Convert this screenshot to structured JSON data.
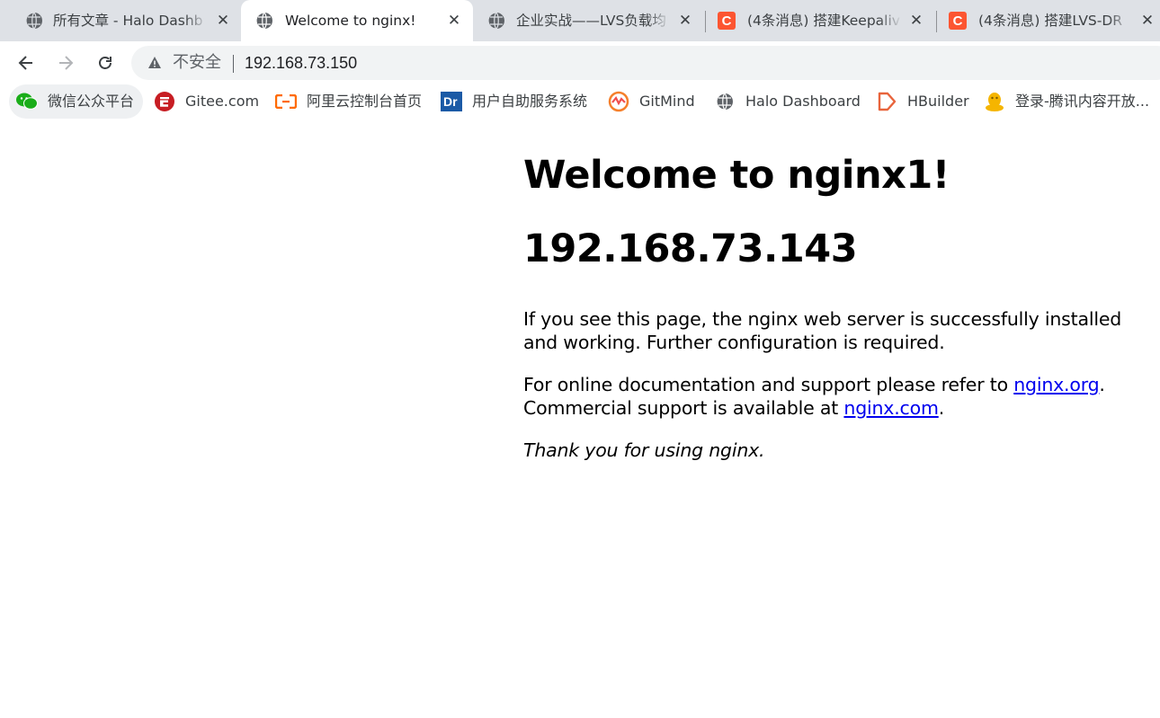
{
  "tabs": [
    {
      "title": "所有文章 - Halo Dashb",
      "favicon": "globe-icon",
      "active": false
    },
    {
      "title": "Welcome to nginx!",
      "favicon": "globe-icon",
      "active": true
    },
    {
      "title": "企业实战——LVS负载均",
      "favicon": "globe-icon",
      "active": false
    },
    {
      "title": "(4条消息) 搭建Keepaliv",
      "favicon": "csdn-icon",
      "active": false
    },
    {
      "title": "(4条消息) 搭建LVS-DR",
      "favicon": "csdn-icon",
      "active": false
    }
  ],
  "toolbar": {
    "security_label": "不安全",
    "url": "192.168.73.150"
  },
  "bookmarks": [
    {
      "label": "微信公众平台",
      "icon": "wechat-icon"
    },
    {
      "label": "Gitee.com",
      "icon": "gitee-icon"
    },
    {
      "label": "阿里云控制台首页",
      "icon": "aliyun-icon"
    },
    {
      "label": "用户自助服务系统",
      "icon": "drcom-icon"
    },
    {
      "label": "GitMind",
      "icon": "gitmind-icon"
    },
    {
      "label": "Halo Dashboard",
      "icon": "globe-icon"
    },
    {
      "label": "HBuilder",
      "icon": "hbuilder-icon"
    },
    {
      "label": "登录-腾讯内容开放...",
      "icon": "qq-penguin-icon"
    }
  ],
  "page": {
    "heading": "Welcome to nginx1!",
    "ip_heading": "192.168.73.143",
    "para1": "If you see this page, the nginx web server is successfully installed and working. Further configuration is required.",
    "para2_prefix": "For online documentation and support please refer to ",
    "link_org": "nginx.org",
    "para2_mid": ".",
    "para2_line2": "Commercial support is available at ",
    "link_com": "nginx.com",
    "para2_suffix": ".",
    "thanks": "Thank you for using nginx."
  },
  "colors": {
    "tabstrip": "#dee1e6",
    "link": "#0000ee",
    "csdn": "#fc5531"
  }
}
